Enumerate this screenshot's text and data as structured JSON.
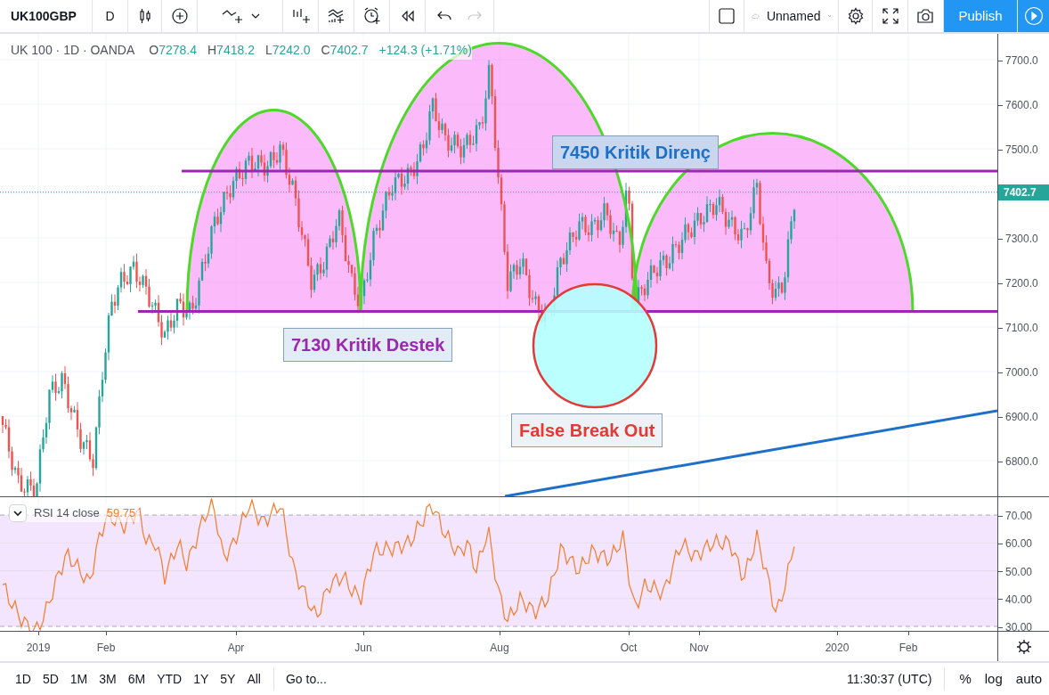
{
  "toolbar": {
    "symbol": "UK100GBP",
    "interval": "D",
    "layout_name": "Unnamed",
    "publish": "Publish"
  },
  "legend": {
    "title": "UK 100 · 1D · OANDA",
    "ohlc": [
      {
        "label": "O",
        "value": "7278.4"
      },
      {
        "label": "H",
        "value": "7418.2"
      },
      {
        "label": "L",
        "value": "7242.0"
      },
      {
        "label": "C",
        "value": "7402.7"
      }
    ],
    "change": "+124.3 (+1.71%)"
  },
  "annotations": [
    {
      "kind": "resistance",
      "text": "7450 Kritik Direnç"
    },
    {
      "kind": "support",
      "text": "7130 Kritik Destek"
    },
    {
      "kind": "false_break",
      "text": "False Break Out"
    }
  ],
  "price_axis": {
    "ticks": [
      "7700.0",
      "7600.0",
      "7500.0",
      "7300.0",
      "7200.0",
      "7100.0",
      "7000.0",
      "6900.0",
      "6800.0"
    ],
    "last_price": "7402.7"
  },
  "rsi": {
    "label": "RSI 14 close",
    "value": "59.75",
    "ticks": [
      "70.00",
      "60.00",
      "50.00",
      "40.00",
      "30.00"
    ]
  },
  "time_axis": {
    "ticks": [
      "2019",
      "Feb",
      "Apr",
      "Jun",
      "Aug",
      "Oct",
      "Nov",
      "2020",
      "Feb"
    ]
  },
  "bottom_bar": {
    "ranges": [
      "1D",
      "5D",
      "1M",
      "3M",
      "6M",
      "YTD",
      "1Y",
      "5Y",
      "All"
    ],
    "goto": "Go to...",
    "time": "11:30:37 (UTC)",
    "options": [
      "%",
      "log",
      "auto"
    ]
  }
}
